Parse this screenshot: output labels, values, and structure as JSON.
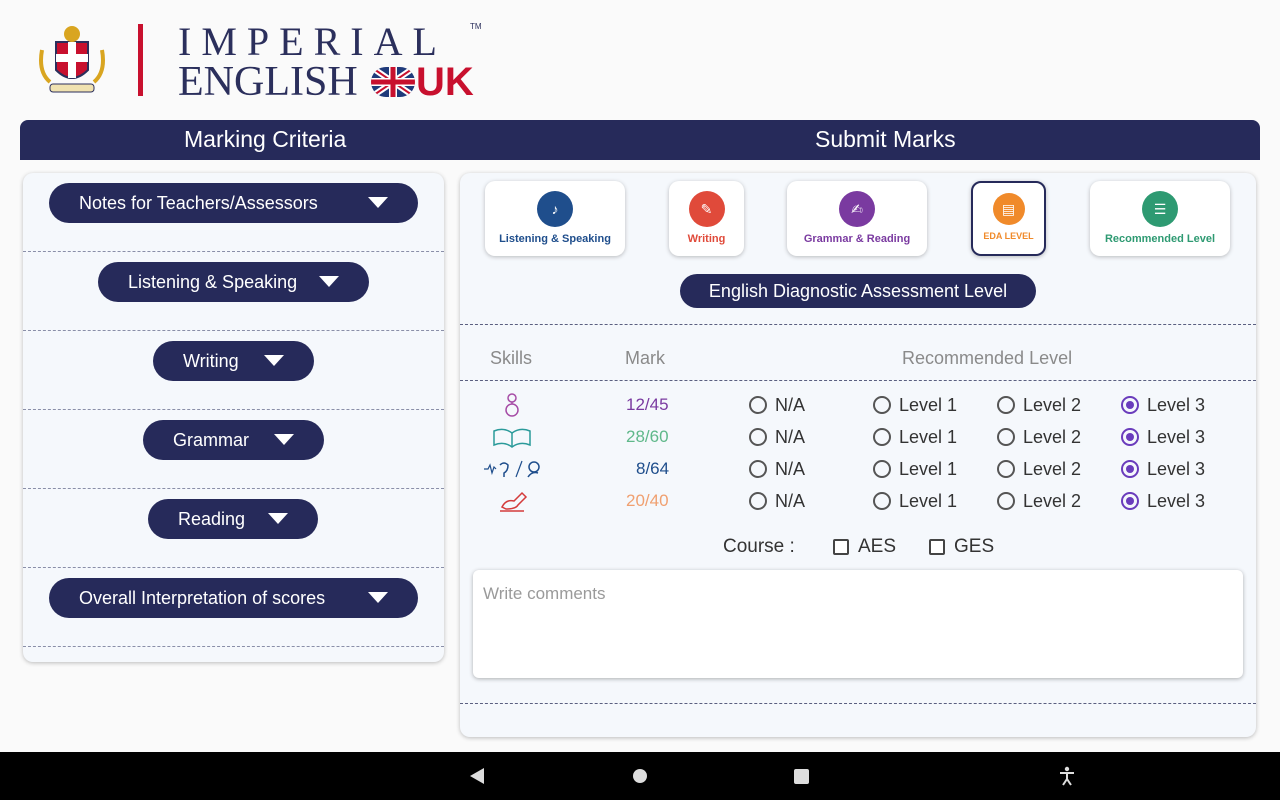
{
  "brand": {
    "line1": "IMPERIAL",
    "line2": "ENGLISH",
    "uk": "UK",
    "tm": "TM"
  },
  "header": {
    "left_title": "Marking Criteria",
    "right_title": "Submit Marks"
  },
  "criteria": [
    {
      "label": "Notes for Teachers/Assessors"
    },
    {
      "label": "Listening & Speaking"
    },
    {
      "label": "Writing"
    },
    {
      "label": "Grammar"
    },
    {
      "label": "Reading"
    },
    {
      "label": "Overall Interpretation of scores"
    }
  ],
  "tabs": [
    {
      "label": "Listening & Speaking",
      "color": "#1f4e8c",
      "text_color": "#1f4e8c",
      "icon": "listening-icon"
    },
    {
      "label": "Writing",
      "color": "#e04a3a",
      "text_color": "#e04a3a",
      "icon": "writing-icon"
    },
    {
      "label": "Grammar & Reading",
      "color": "#7a3aa0",
      "text_color": "#7a3aa0",
      "icon": "reading-icon"
    },
    {
      "label": "EDA LEVEL",
      "color": "#f08a2a",
      "text_color": "#f08a2a",
      "icon": "eda-icon"
    },
    {
      "label": "Recommended Level",
      "color": "#2e9a72",
      "text_color": "#2e9a72",
      "icon": "recommended-icon"
    }
  ],
  "eda_title": "English Diagnostic Assessment Level",
  "columns": {
    "skills": "Skills",
    "mark": "Mark",
    "level": "Recommended Level"
  },
  "rows": [
    {
      "skill": "grammar",
      "icon": "grammar-icon",
      "mark": "12/45",
      "mark_color": "#7a3aa0",
      "options": [
        "N/A",
        "Level 1",
        "Level 2",
        "Level 3"
      ],
      "selected": "Level 3"
    },
    {
      "skill": "reading",
      "icon": "book-icon",
      "mark": "28/60",
      "mark_color": "#5fb88a",
      "options": [
        "N/A",
        "Level 1",
        "Level 2",
        "Level 3"
      ],
      "selected": "Level 3"
    },
    {
      "skill": "listening-speaking",
      "icon": "listening-speaking-icon",
      "mark": "8/64",
      "mark_color": "#1f4e8c",
      "options": [
        "N/A",
        "Level 1",
        "Level 2",
        "Level 3"
      ],
      "selected": "Level 3"
    },
    {
      "skill": "writing",
      "icon": "writing-hand-icon",
      "mark": "20/40",
      "mark_color": "#f0a070",
      "options": [
        "N/A",
        "Level 1",
        "Level 2",
        "Level 3"
      ],
      "selected": "Level 3"
    }
  ],
  "course": {
    "label": "Course :",
    "options": [
      "AES",
      "GES"
    ]
  },
  "comments": {
    "placeholder": "Write comments"
  }
}
